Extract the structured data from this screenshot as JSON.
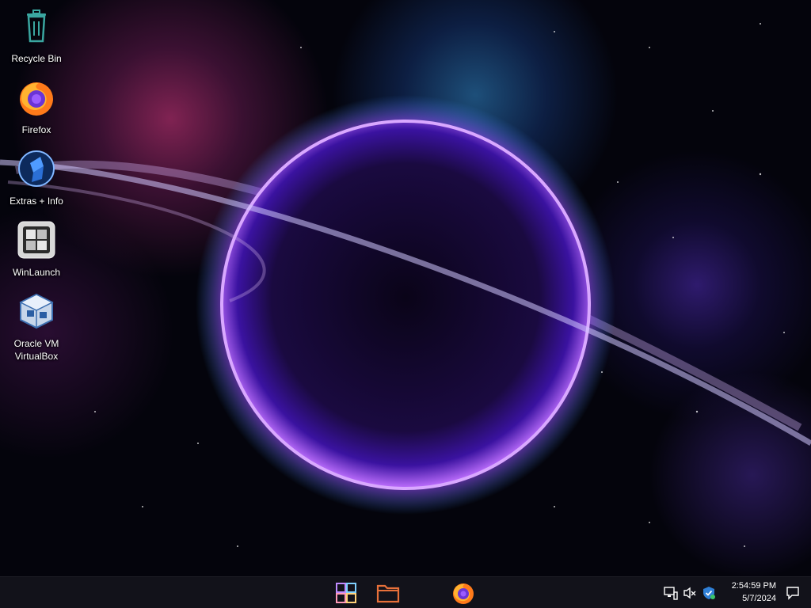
{
  "desktop": {
    "icons": [
      {
        "label": "Recycle Bin"
      },
      {
        "label": "Firefox"
      },
      {
        "label": "Extras + Info"
      },
      {
        "label": "WinLaunch"
      },
      {
        "label": "Oracle VM VirtualBox"
      }
    ]
  },
  "taskbar": {
    "start_icon": "windows-start-icon",
    "pinned": [
      "file-explorer-icon",
      "firefox-icon"
    ],
    "tray_icons": [
      "network-icon",
      "volume-muted-icon",
      "security-shield-icon"
    ],
    "clock": {
      "time": "2:54:59 PM",
      "date": "5/7/2024"
    },
    "notification_icon": "notification-icon"
  },
  "colors": {
    "taskbar_bg": "#14141c",
    "explorer_orange": "#e8703a",
    "planet_glow": "#8a3cff",
    "recycle_teal": "#3aa6a0"
  }
}
